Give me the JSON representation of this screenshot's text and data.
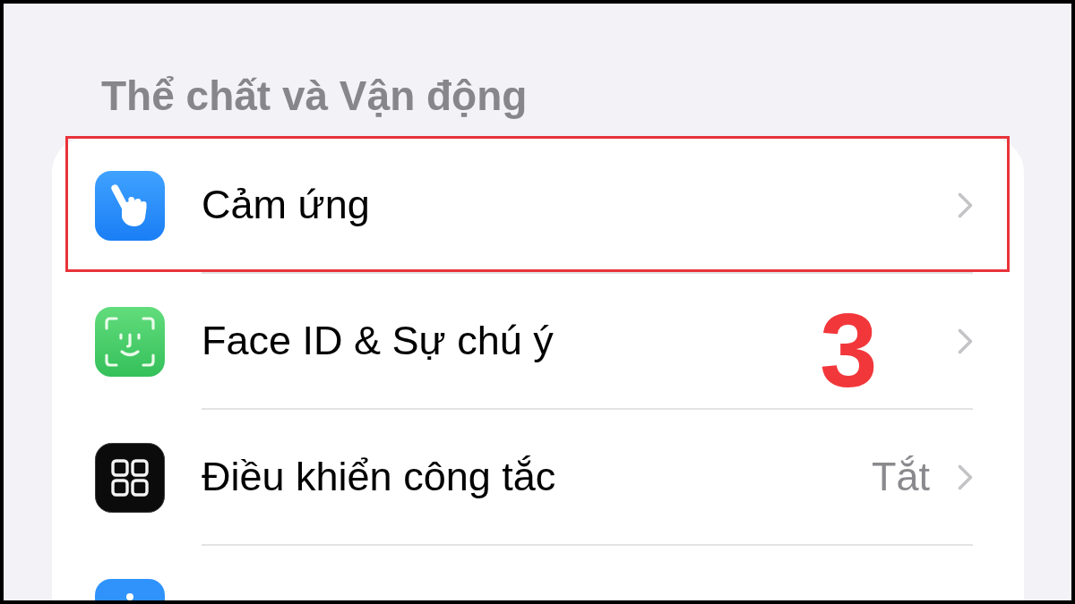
{
  "section": {
    "title": "Thể chất và Vận động"
  },
  "rows": [
    {
      "label": "Cảm ứng",
      "highlighted": true
    },
    {
      "label": "Face ID & Sự chú ý",
      "highlighted": false
    },
    {
      "label": "Điều khiển công tắc",
      "value": "Tắt",
      "highlighted": false
    }
  ],
  "more_rows_below": true,
  "step_number": "3"
}
